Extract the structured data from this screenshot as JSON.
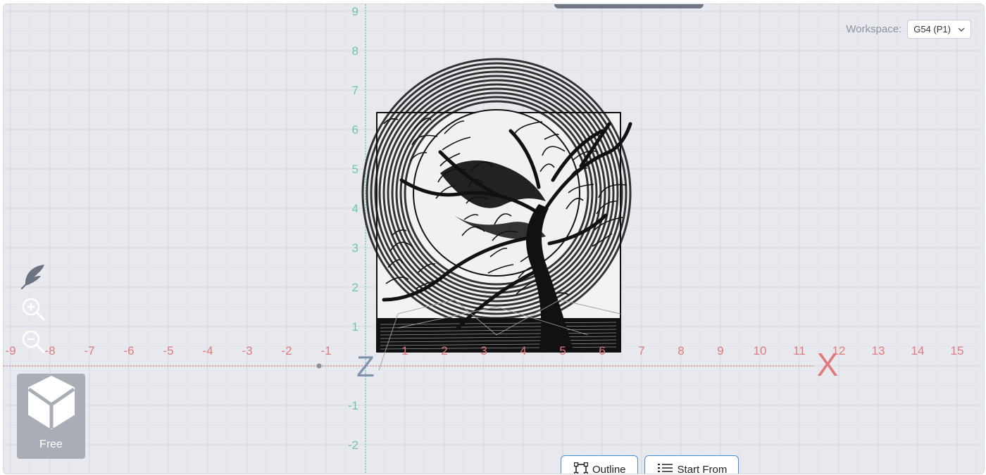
{
  "workspace": {
    "label": "Workspace:",
    "selected": "G54 (P1)"
  },
  "view": {
    "mode_label": "Free"
  },
  "axes": {
    "x_label": "X",
    "z_label": "Z",
    "x_ticks": [
      "-9",
      "-8",
      "-7",
      "-6",
      "-5",
      "-4",
      "-3",
      "-2",
      "-1",
      "1",
      "2",
      "3",
      "4",
      "5",
      "6",
      "7",
      "8",
      "9",
      "10",
      "11",
      "12",
      "13",
      "14",
      "15"
    ],
    "y_ticks": [
      "9",
      "8",
      "7",
      "6",
      "5",
      "4",
      "3",
      "2",
      "1",
      "-1",
      "-2"
    ],
    "x_color": "#e07a7a",
    "y_color": "#6cc7a3"
  },
  "buttons": {
    "outline": "Outline",
    "start_from": "Start From"
  },
  "icons": {
    "tool1": "feather-icon",
    "tool2": "zoom-in-icon",
    "tool3": "zoom-out-icon",
    "view_cube": "cube-icon",
    "outline": "outline-frame-icon",
    "start_from": "list-icon",
    "workspace_select": "chevron-down-icon"
  }
}
